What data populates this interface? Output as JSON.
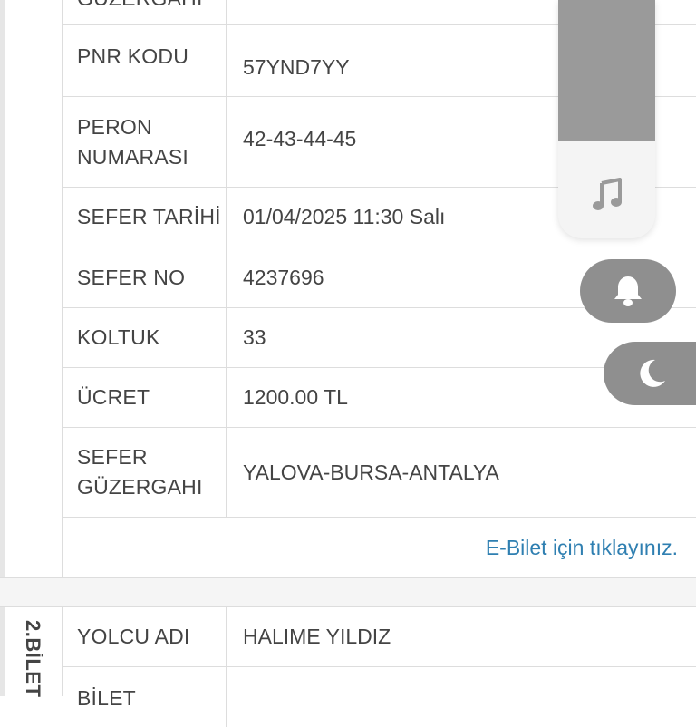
{
  "ticket1": {
    "rows": [
      {
        "label": "GÜZERGAHI",
        "value": ""
      },
      {
        "label": "PNR KODU",
        "value": "57YND7YY"
      },
      {
        "label_lines": [
          "PERON",
          "NUMARASI"
        ],
        "value": "42-43-44-45"
      },
      {
        "label": "SEFER TARİHİ",
        "value": "01/04/2025 11:30 Salı"
      },
      {
        "label": "SEFER NO",
        "value": "4237696"
      },
      {
        "label": "KOLTUK",
        "value": "33"
      },
      {
        "label": "ÜCRET",
        "value": "1200.00 TL"
      },
      {
        "label_lines": [
          "SEFER",
          "GÜZERGAHI"
        ],
        "value": "YALOVA-BURSA-ANTALYA"
      }
    ],
    "ebilet_link": "E-Bilet için tıklayınız."
  },
  "ticket2": {
    "number_label": "2.BİLET",
    "rows": [
      {
        "label": "YOLCU ADI",
        "value": "HALIME YILDIZ"
      },
      {
        "label": "BİLET",
        "value": ""
      }
    ]
  },
  "controls": {
    "volume_level_percent": 59,
    "icons": [
      "music-note-icon",
      "bell-icon",
      "moon-icon"
    ]
  },
  "colors": {
    "link": "#2f7fb1",
    "border": "#dddddd",
    "control_gray": "#8f8f8f",
    "slider_fill": "#9a9a9a"
  }
}
